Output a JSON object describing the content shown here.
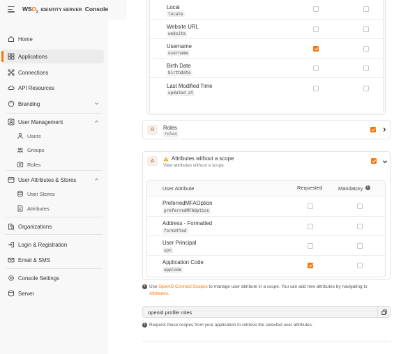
{
  "header": {
    "logo_prefix": "WS",
    "logo_o": "O",
    "logo_suffix": "2",
    "product": "IDENTITY SERVER",
    "console": "Console"
  },
  "sidebar": {
    "items": [
      {
        "label": "Home",
        "icon": "home-icon"
      },
      {
        "label": "Applications",
        "icon": "grid-icon",
        "active": true
      },
      {
        "label": "Connections",
        "icon": "connections-icon"
      },
      {
        "label": "API Resources",
        "icon": "cloud-icon"
      },
      {
        "label": "Branding",
        "icon": "palette-icon"
      },
      {
        "label": "User Management",
        "icon": "user-management-icon"
      },
      {
        "label": "Users",
        "icon": "user-icon"
      },
      {
        "label": "Groups",
        "icon": "group-icon"
      },
      {
        "label": "Roles",
        "icon": "roles-icon"
      },
      {
        "label": "User Attributes & Stores",
        "icon": "attributes-stores-icon"
      },
      {
        "label": "User Stores",
        "icon": "database-icon"
      },
      {
        "label": "Attributes",
        "icon": "attributes-icon"
      },
      {
        "label": "Organizations",
        "icon": "building-icon"
      },
      {
        "label": "Login & Registration",
        "icon": "login-icon"
      },
      {
        "label": "Email & SMS",
        "icon": "email-icon"
      },
      {
        "label": "Console Settings",
        "icon": "settings-icon"
      },
      {
        "label": "Server",
        "icon": "server-icon"
      }
    ]
  },
  "profile_rows": [
    {
      "label": "Local",
      "code": "locale",
      "requested": false,
      "mandatory": false
    },
    {
      "label": "Website URL",
      "code": "website",
      "requested": false,
      "mandatory": false
    },
    {
      "label": "Username",
      "code": "username",
      "requested": true,
      "mandatory": false
    },
    {
      "label": "Birth Date",
      "code": "birthdate",
      "requested": false,
      "mandatory": false
    },
    {
      "label": "Last Modified Time",
      "code": "updated_at",
      "requested": false,
      "mandatory": false
    }
  ],
  "roles_card": {
    "avatar": "R",
    "title": "Roles",
    "code": "roles",
    "checked": true
  },
  "no_scope_card": {
    "avatar": "A",
    "title": "Attributes without a scope",
    "subtitle": "View attributes without a scope",
    "checked": true
  },
  "attr_table": {
    "headers": {
      "attribute": "User Attribute",
      "requested": "Requested",
      "mandatory": "Mandatory"
    },
    "rows": [
      {
        "label": "PreferredMFAOption",
        "code": "preferredMFAOption",
        "requested": false,
        "mandatory": false
      },
      {
        "label": "Address - Formatted",
        "code": "formatted",
        "requested": false,
        "mandatory": false
      },
      {
        "label": "User Principal",
        "code": "upn",
        "requested": false,
        "mandatory": false
      },
      {
        "label": "Application Code",
        "code": "appCode",
        "requested": true,
        "mandatory": false
      }
    ]
  },
  "info": {
    "use": "Use",
    "link1": "OpenID Connect Scopes",
    "middle": "to manage user attribute in a scope. You can add new attributes by navigating to",
    "link2": "Attributes",
    "end": "."
  },
  "scopes": {
    "value": "openid profile roles"
  },
  "scopes_hint": "Request these scopes from your application to retrieve the selected user attributes.",
  "colors": {
    "accent": "#ff7300",
    "sidebar_bg": "#f8f8f8"
  }
}
